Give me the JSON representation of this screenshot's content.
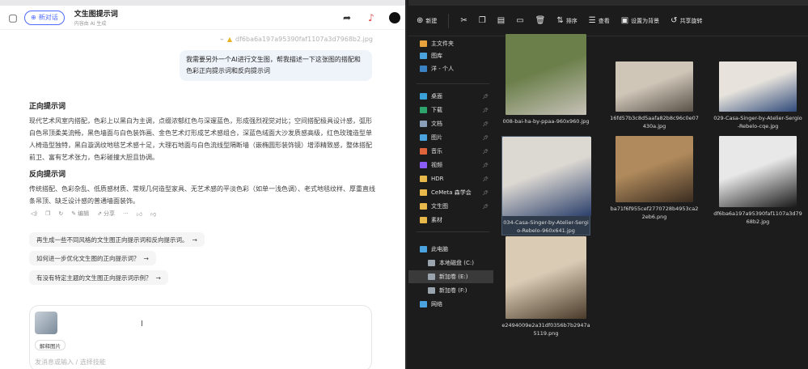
{
  "chat": {
    "new_chat_label": "新对话",
    "title": "文生图提示词",
    "subtitle": "内容由 AI 生成",
    "file_ref": "df6ba6a197a95390faf1107a3d7968b2.jpg",
    "user_message": "我需要另外一个AI进行文生图，帮我描述一下这张图的搭配和色彩正向提示词和反向提示词",
    "positive_heading": "正向提示词",
    "positive_text": "现代艺术风室内搭配，色彩上以黑白为主调，点缀浓郁红色与深邃蓝色，形成强烈视觉对比；空间搭配极具设计感，弧形白色吊顶柔美流畅，黑色墙面与白色装饰画、金色艺术灯形成艺术感组合，深蓝色绒面大沙发质感高级，红色玫瑰造型单人椅造型独特，黑白漩涡纹地毯艺术感十足，大理石地面与白色流线型隔断墙（嵌椭圆形装饰镜）增添精致感，整体搭配前卫、富有艺术张力，色彩碰撞大胆且协调。",
    "negative_heading": "反向提示词",
    "negative_text": "传统搭配、色彩杂乱、低质感材质、常规几何造型家具、无艺术感的平淡色彩（如单一浅色调）、老式地毯纹样、厚重直线条吊顶、缺乏设计感的普通墙面装饰。",
    "actions": [
      "编辑",
      "分享"
    ],
    "suggestions": [
      "再生成一些不同风格的文生图正向提示词和反向提示词。",
      "如何进一步优化文生图的正向提示词？",
      "有没有特定主题的文生图正向提示词示例？"
    ],
    "chip_label": "解释图片",
    "input_placeholder": "发消息或输入 / 选择技能"
  },
  "explorer": {
    "toolbar": {
      "new_label": "新建",
      "sort_label": "排序",
      "view_label": "查看",
      "set_bg_label": "设置为背景",
      "share_label": "共享旋转"
    },
    "nav": [
      {
        "label": "主文件夹",
        "color": "#e8a23b",
        "pinned": false
      },
      {
        "label": "图库",
        "color": "#4aa3df",
        "pinned": false
      },
      {
        "label": "洋 - 个人",
        "color": "#3b82c4",
        "pinned": false
      },
      {
        "label": "桌面",
        "color": "#3aa0d8",
        "pinned": true
      },
      {
        "label": "下载",
        "color": "#2ea36b",
        "pinned": true
      },
      {
        "label": "文档",
        "color": "#8aa0b8",
        "pinned": true
      },
      {
        "label": "图片",
        "color": "#4aa3df",
        "pinned": true
      },
      {
        "label": "音乐",
        "color": "#e0643b",
        "pinned": true
      },
      {
        "label": "视频",
        "color": "#8b5cf6",
        "pinned": true
      },
      {
        "label": "HDR",
        "color": "#e8b84a",
        "pinned": true
      },
      {
        "label": "CeMeta 森学会",
        "color": "#e8b84a",
        "pinned": true
      },
      {
        "label": "文生图",
        "color": "#e8b84a",
        "pinned": true
      },
      {
        "label": "素材",
        "color": "#e8b84a",
        "pinned": false
      },
      {
        "label": "此电脑",
        "color": "#4aa3df",
        "pinned": false
      },
      {
        "label": "本地磁盘 (C:)",
        "color": "#9aa4ae",
        "pinned": false
      },
      {
        "label": "新加卷 (E:)",
        "color": "#9aa4ae",
        "pinned": false
      },
      {
        "label": "新加卷 (F:)",
        "color": "#9aa4ae",
        "pinned": false
      },
      {
        "label": "网络",
        "color": "#4aa3df",
        "pinned": false
      }
    ],
    "files": [
      {
        "name": "008-bai-ha-by-ppaa-960x960.jpg",
        "colors": [
          "#6b7f4a",
          "#c7c2b8"
        ]
      },
      {
        "name": "16fd57b3c8d5aafa82b8c96c0e07430a.jpg",
        "colors": [
          "#cfc6b8",
          "#5a5148"
        ]
      },
      {
        "name": "029-Casa-Singer-by-Atelier-Sergio-Rebelo-cqe.jpg",
        "colors": [
          "#e7e3dc",
          "#2f4a7a"
        ]
      },
      {
        "name": "034-Casa-Singer-by-Atelier-Sergio-Rebelo-960x641.jpg",
        "colors": [
          "#dcd8d2",
          "#2b3f6b"
        ]
      },
      {
        "name": "ba71f6f955cef2770728b4953ca22eb6.png",
        "colors": [
          "#b08a5c",
          "#3a2c20"
        ]
      },
      {
        "name": "df6ba6a197a95390faf1107a3d7968b2.jpg",
        "colors": [
          "#e8e8e8",
          "#1a1a1a"
        ]
      },
      {
        "name": "e2494009e2a31df0356b7b2947a5119.png",
        "colors": [
          "#d9cbb4",
          "#4a3a2a"
        ]
      }
    ]
  }
}
